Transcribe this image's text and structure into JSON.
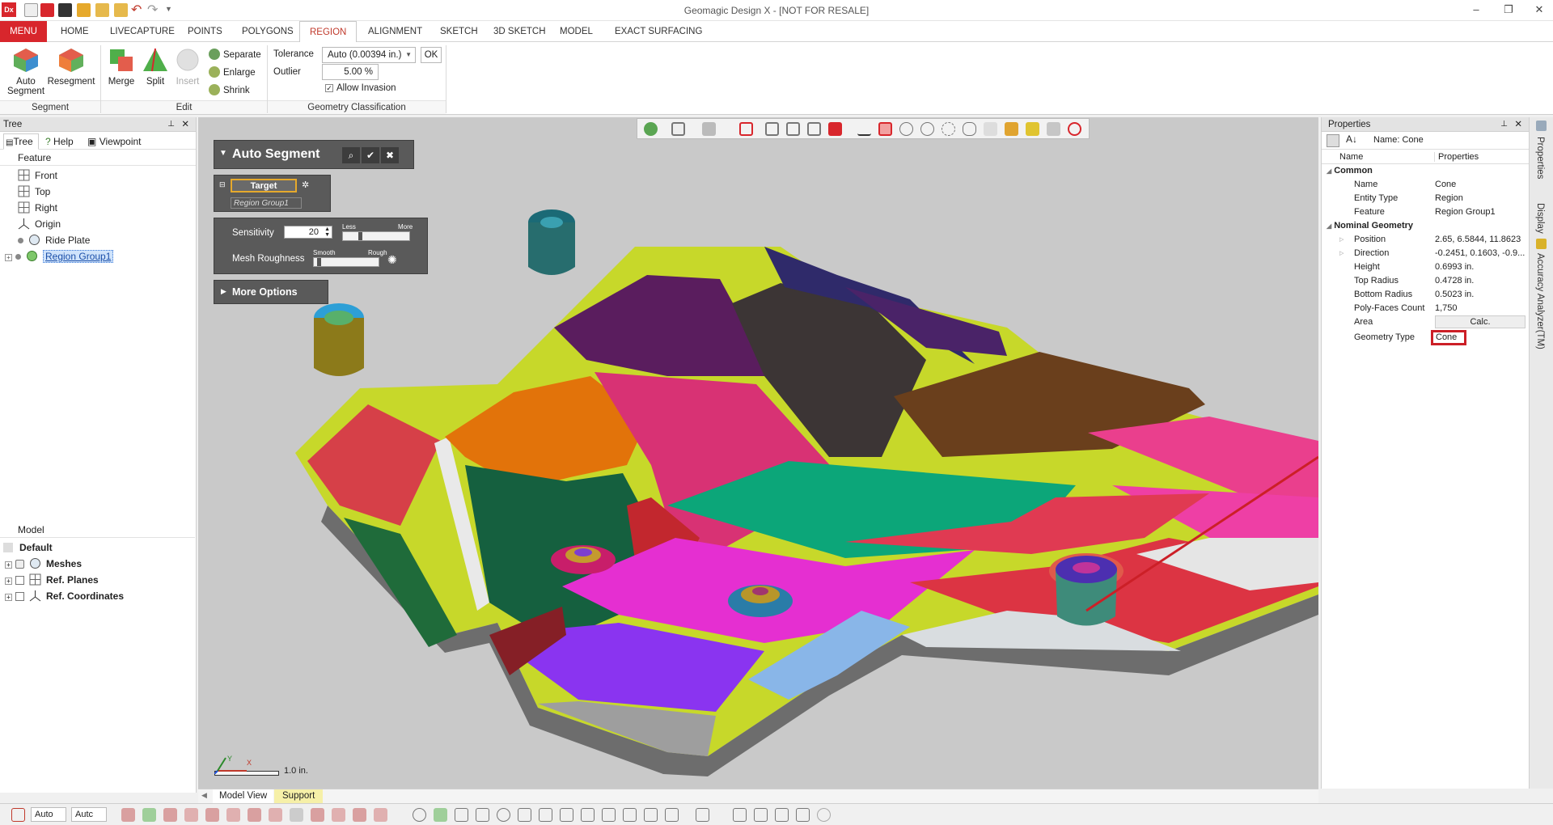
{
  "app": {
    "title": "Geomagic Design X - [NOT FOR RESALE]",
    "logo": "Dx",
    "window_controls": [
      "–",
      "❐",
      "✕"
    ]
  },
  "ribbon_tabs": [
    {
      "label": "MENU"
    },
    {
      "label": "HOME"
    },
    {
      "label": "LIVECAPTURE"
    },
    {
      "label": "POINTS"
    },
    {
      "label": "POLYGONS"
    },
    {
      "label": "REGION"
    },
    {
      "label": "ALIGNMENT"
    },
    {
      "label": "SKETCH"
    },
    {
      "label": "3D SKETCH"
    },
    {
      "label": "MODEL"
    },
    {
      "label": "EXACT SURFACING"
    }
  ],
  "ribbon": {
    "segment": {
      "group": "Segment",
      "auto_segment": "Auto\nSegment",
      "resegment": "Resegment"
    },
    "edit": {
      "group": "Edit",
      "merge": "Merge",
      "split": "Split",
      "insert": "Insert",
      "separate": "Separate",
      "enlarge": "Enlarge",
      "shrink": "Shrink"
    },
    "geometry": {
      "group": "Geometry Classification",
      "tolerance_label": "Tolerance",
      "tolerance_value": "Auto (0.00394 in.)",
      "ok": "OK",
      "outlier_label": "Outlier",
      "outlier_value": "5.00 %",
      "allow_invasion": "Allow Invasion"
    }
  },
  "left_panel": {
    "header": "Tree",
    "tabs": [
      "Tree",
      "Help",
      "Viewpoint"
    ],
    "feature_header": "Feature",
    "feature_items": [
      "Front",
      "Top",
      "Right",
      "Origin",
      "Ride Plate",
      "Region Group1"
    ],
    "model_header": "Model",
    "model_items": [
      "Default",
      "Meshes",
      "Ref. Planes",
      "Ref. Coordinates"
    ]
  },
  "auto_segment": {
    "title": "Auto Segment",
    "target_label": "Target",
    "target_value": "Region Group1",
    "sensitivity_label": "Sensitivity",
    "sensitivity_value": "20",
    "less": "Less",
    "more": "More",
    "roughness_label": "Mesh Roughness",
    "smooth": "Smooth",
    "rough": "Rough",
    "more_options": "More Options",
    "sensitivity_level": 0.25,
    "roughness_level": 0.05
  },
  "viewport": {
    "scale_label": "1.0 in.",
    "axis_x": "X",
    "axis_y": "Y"
  },
  "properties": {
    "header": "Properties",
    "name_label": "Name: Cone",
    "col_name": "Name",
    "col_props": "Properties",
    "common": "Common",
    "nominal": "Nominal Geometry",
    "rows": [
      {
        "k": "Name",
        "v": "Cone"
      },
      {
        "k": "Entity Type",
        "v": "Region"
      },
      {
        "k": "Feature",
        "v": "Region Group1"
      }
    ],
    "geo_rows": [
      {
        "k": "Position",
        "v": "2.65, 6.5844, 11.8623"
      },
      {
        "k": "Direction",
        "v": "-0.2451, 0.1603, -0.9..."
      },
      {
        "k": "Height",
        "v": "0.6993 in."
      },
      {
        "k": "Top Radius",
        "v": "0.4728 in."
      },
      {
        "k": "Bottom Radius",
        "v": "0.5023 in."
      },
      {
        "k": "Poly-Faces Count",
        "v": "1,750"
      },
      {
        "k": "Area",
        "v": "Calc."
      },
      {
        "k": "Geometry Type",
        "v": "Cone"
      }
    ]
  },
  "side_tabs": [
    "Properties",
    "Display",
    "Accuracy Analyzer(TM)"
  ],
  "view_tabs": [
    "Model View",
    "Support"
  ],
  "status": {
    "auto1": "Auto",
    "auto2": "Autc"
  },
  "colors": {
    "accent": "#d8262c",
    "highlight_box": "#cc1f27",
    "yellow_boundary": "#c8e41b"
  }
}
